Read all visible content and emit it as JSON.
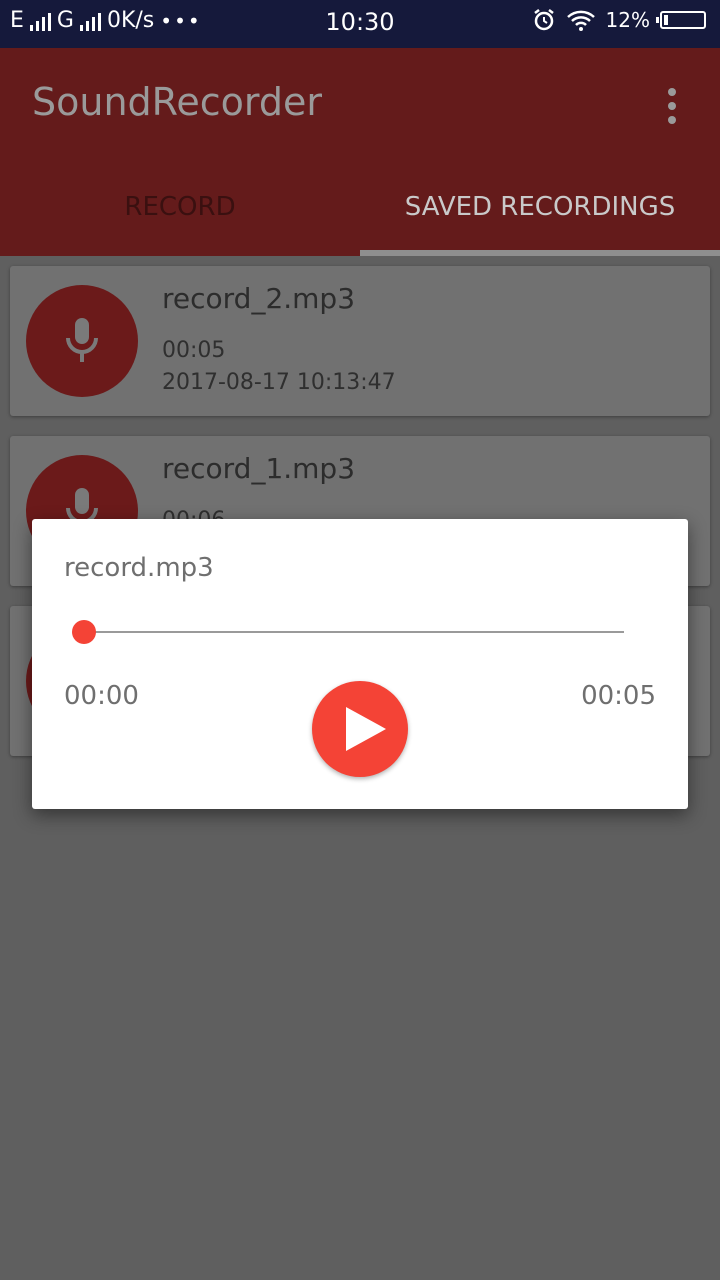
{
  "status_bar": {
    "network1": "E",
    "network2": "G",
    "speed": "0K/s",
    "time": "10:30",
    "battery": "12%"
  },
  "app": {
    "title": "SoundRecorder",
    "tabs": [
      {
        "label": "RECORD",
        "active": false
      },
      {
        "label": "SAVED RECORDINGS",
        "active": true
      }
    ]
  },
  "recordings": [
    {
      "name": "record_2.mp3",
      "duration": "00:05",
      "date": "2017-08-17 10:13:47"
    },
    {
      "name": "record_1.mp3",
      "duration": "00:06",
      "date": ""
    },
    {
      "name": "",
      "duration": "",
      "date": ""
    }
  ],
  "dialog": {
    "title": "record.mp3",
    "current_time": "00:00",
    "total_time": "00:05",
    "progress": 0
  },
  "colors": {
    "accent": "#f44336",
    "appbar": "#641b1b",
    "statusbar": "#15193b"
  }
}
